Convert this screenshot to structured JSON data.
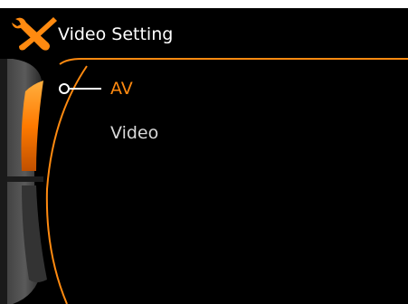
{
  "window": {
    "title": "Video Setting",
    "title_icon": "tools-icon"
  },
  "menu": {
    "items": [
      {
        "label": "AV",
        "selected": true
      },
      {
        "label": "Video",
        "selected": false
      }
    ]
  },
  "colors": {
    "accent": "#ff8a10",
    "background": "#000000",
    "text": "#ffffff",
    "text_dim": "#d8d8d8"
  }
}
